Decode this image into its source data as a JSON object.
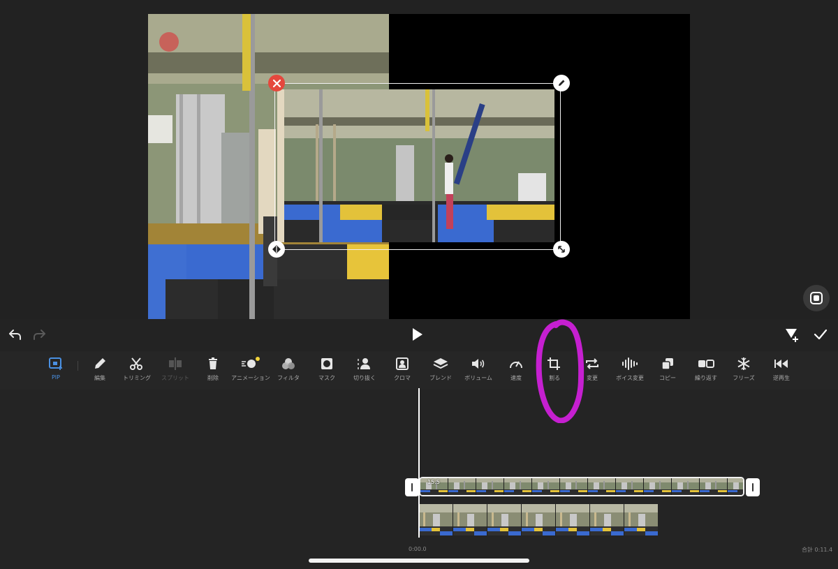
{
  "preview": {
    "fullscreen_icon": "fullscreen-icon",
    "pip_handles": [
      "close-icon",
      "pencil-icon",
      "flip-icon",
      "resize-icon"
    ]
  },
  "transport": {
    "undo_icon": "undo-icon",
    "redo_icon": "redo-icon",
    "play_icon": "play-icon",
    "keyframe_icon": "keyframe-add-icon",
    "done_icon": "checkmark-icon"
  },
  "toolbar": {
    "items": [
      {
        "label": "PIP",
        "icon": "pip-icon",
        "state": "active"
      },
      {
        "label": "編集",
        "icon": "pencil-icon",
        "state": "normal"
      },
      {
        "label": "トリミング",
        "icon": "scissors-icon",
        "state": "normal"
      },
      {
        "label": "スプリット",
        "icon": "split-icon",
        "state": "disabled"
      },
      {
        "label": "削除",
        "icon": "trash-icon",
        "state": "normal"
      },
      {
        "label": "アニメーション",
        "icon": "animation-icon",
        "state": "normal"
      },
      {
        "label": "フィルタ",
        "icon": "filter-icon",
        "state": "normal"
      },
      {
        "label": "マスク",
        "icon": "mask-icon",
        "state": "normal"
      },
      {
        "label": "切り抜く",
        "icon": "cutout-icon",
        "state": "normal"
      },
      {
        "label": "クロマ",
        "icon": "chroma-icon",
        "state": "normal"
      },
      {
        "label": "ブレンド",
        "icon": "blend-icon",
        "state": "normal"
      },
      {
        "label": "ボリューム",
        "icon": "volume-icon",
        "state": "normal"
      },
      {
        "label": "速度",
        "icon": "speed-icon",
        "state": "normal"
      },
      {
        "label": "割る",
        "icon": "crop-icon",
        "state": "normal"
      },
      {
        "label": "変更",
        "icon": "replace-icon",
        "state": "normal"
      },
      {
        "label": "ボイス変更",
        "icon": "voice-change-icon",
        "state": "normal"
      },
      {
        "label": "コピー",
        "icon": "copy-icon",
        "state": "normal"
      },
      {
        "label": "繰り返す",
        "icon": "repeat-icon",
        "state": "normal"
      },
      {
        "label": "フリーズ",
        "icon": "freeze-icon",
        "state": "normal"
      },
      {
        "label": "逆再生",
        "icon": "reverse-icon",
        "state": "normal"
      }
    ]
  },
  "timeline": {
    "clip_duration": "15.5",
    "start_time": "0:00.0",
    "total_time": "合計 0:11.4"
  },
  "colors": {
    "accent": "#4a90e2",
    "annotation": "#d41fe0",
    "close": "#e5483d"
  }
}
